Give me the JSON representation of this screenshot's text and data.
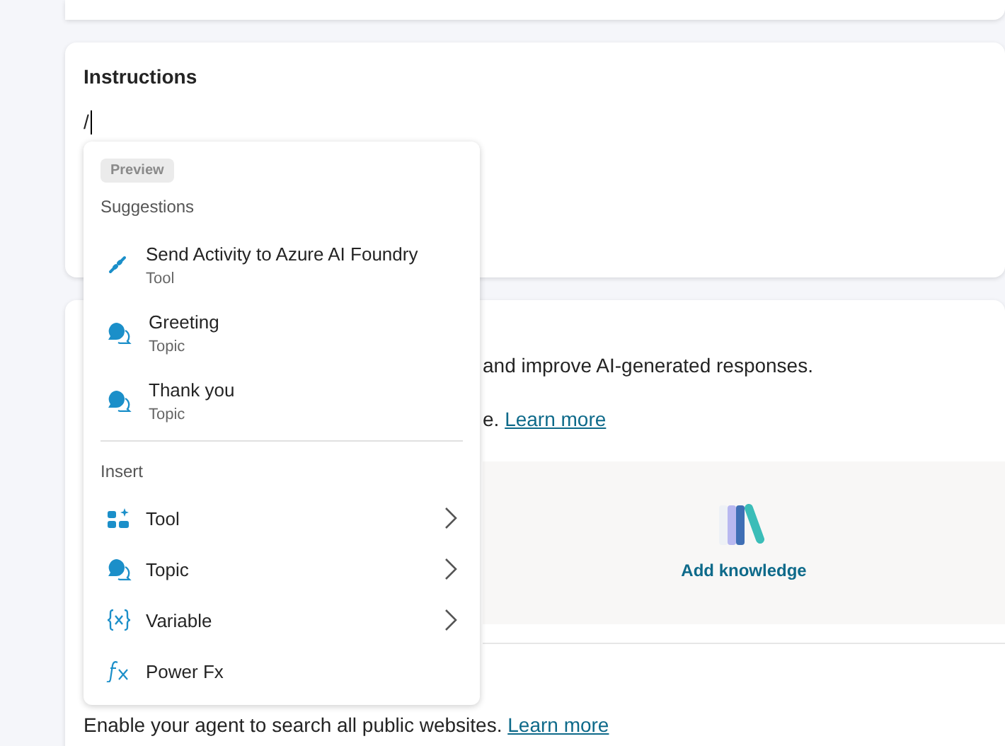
{
  "instructions": {
    "title": "Instructions",
    "value": "/"
  },
  "knowledge": {
    "description": "and improve AI-generated responses.",
    "line_2": "e.",
    "learn_more": "Learn more",
    "add_button": "Add knowledge"
  },
  "web_search": {
    "description": "Enable your agent to search all public websites.",
    "learn_more": "Learn more"
  },
  "popup": {
    "badge": "Preview",
    "suggestions_heading": "Suggestions",
    "suggestions": [
      {
        "kind": "tool",
        "title": "Send Activity to Azure AI Foundry",
        "subtitle": "Tool"
      },
      {
        "kind": "topic",
        "title": "Greeting",
        "subtitle": "Topic"
      },
      {
        "kind": "topic",
        "title": "Thank you",
        "subtitle": "Topic"
      }
    ],
    "insert_heading": "Insert",
    "insert": [
      {
        "kind": "tool",
        "label": "Tool",
        "submenu": true
      },
      {
        "kind": "topic",
        "label": "Topic",
        "submenu": true
      },
      {
        "kind": "variable",
        "label": "Variable",
        "submenu": true
      },
      {
        "kind": "fx",
        "label": "Power Fx",
        "submenu": false
      }
    ]
  }
}
